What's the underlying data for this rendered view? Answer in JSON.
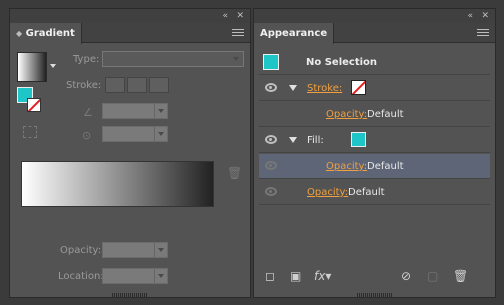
{
  "gradient_panel": {
    "tab": "Gradient",
    "collapse_icon": "«",
    "close_icon": "✕",
    "type_label": "Type:",
    "stroke_label": "Stroke:",
    "opacity_label": "Opacity:",
    "location_label": "Location:"
  },
  "appearance_panel": {
    "tab": "Appearance",
    "collapse_icon": "«",
    "close_icon": "✕",
    "no_selection": "No Selection",
    "rows": [
      {
        "label": "Stroke:",
        "value": ""
      },
      {
        "label": "Opacity:",
        "value": "Default"
      },
      {
        "label": "Fill:",
        "value": ""
      },
      {
        "label": "Opacity:",
        "value": "Default"
      },
      {
        "label": "Opacity:",
        "value": "Default"
      }
    ],
    "fx_label": "fx"
  },
  "colors": {
    "panel_bg": "#535353",
    "teal": "#1ec6c8",
    "link_orange": "#f0a040",
    "selected_row": "#5d6577"
  }
}
